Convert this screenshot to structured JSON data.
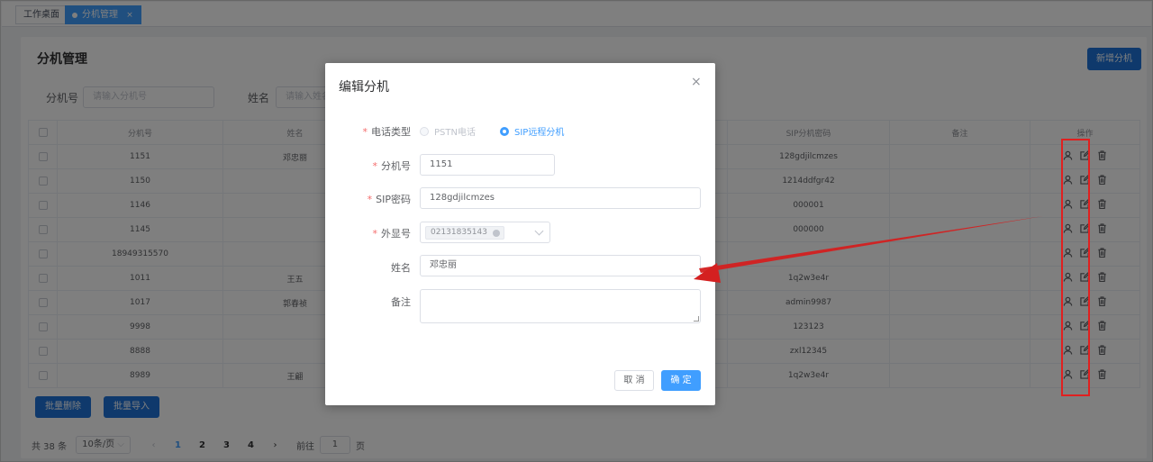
{
  "tabs": [
    {
      "label": "工作桌面"
    },
    {
      "label": "分机管理",
      "close": "×"
    }
  ],
  "page": {
    "title": "分机管理",
    "add_button": "新增分机"
  },
  "filters": {
    "ext_label": "分机号",
    "ext_placeholder": "请输入分机号",
    "name_label": "姓名",
    "name_placeholder": "请输入姓名"
  },
  "table": {
    "headers": {
      "ext": "分机号",
      "name": "姓名",
      "sip_pwd": "SIP分机密码",
      "remark": "备注",
      "ops": "操作"
    },
    "rows": [
      {
        "ext": "1151",
        "name": "邓忠丽",
        "pwd": "128gdjilcmzes"
      },
      {
        "ext": "1150",
        "name": "",
        "pwd": "1214ddfgr42"
      },
      {
        "ext": "1146",
        "name": "",
        "pwd": "000001"
      },
      {
        "ext": "1145",
        "name": "",
        "pwd": "000000"
      },
      {
        "ext": "18949315570",
        "name": "",
        "pwd": ""
      },
      {
        "ext": "1011",
        "name": "王五",
        "pwd": "1q2w3e4r"
      },
      {
        "ext": "1017",
        "name": "郭春祯",
        "pwd": "admin9987"
      },
      {
        "ext": "9998",
        "name": "",
        "pwd": "123123"
      },
      {
        "ext": "8888",
        "name": "",
        "pwd": "zxl12345"
      },
      {
        "ext": "8989",
        "name": "王翩",
        "pwd": "1q2w3e4r"
      }
    ]
  },
  "bulk": {
    "delete": "批量删除",
    "import": "批量导入"
  },
  "pagination": {
    "total": "共 38 条",
    "page_size": "10条/页",
    "pages": [
      "1",
      "2",
      "3",
      "4"
    ],
    "prev": "‹",
    "next": "›",
    "goto_label": "前往",
    "goto_value": "1",
    "goto_suffix": "页"
  },
  "dialog": {
    "title": "编辑分机",
    "close": "×",
    "fields": {
      "type_label": "电话类型",
      "type_options": [
        "PSTN电话",
        "SIP远程分机"
      ],
      "ext_label": "分机号",
      "ext_value": "1151",
      "sip_label": "SIP密码",
      "sip_value": "128gdjilcmzes",
      "caller_label": "外显号",
      "caller_tag": "02131835143",
      "name_label": "姓名",
      "name_value": "邓忠丽",
      "remark_label": "备注",
      "required_mark": "*"
    },
    "cancel": "取 消",
    "confirm": "确 定"
  },
  "colors": {
    "primary": "#1e73d8",
    "accent": "#409eff",
    "annotation": "#e02020"
  },
  "icons": [
    "user-icon",
    "edit-icon",
    "trash-icon",
    "close-icon",
    "chevron-down-icon"
  ]
}
